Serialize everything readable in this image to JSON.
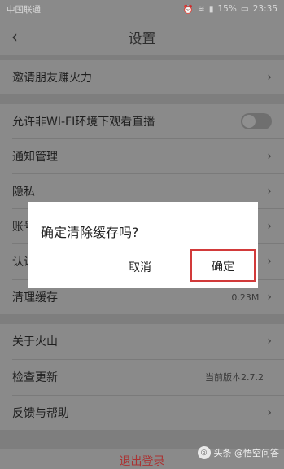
{
  "status_bar": {
    "carrier": "中国联通",
    "battery": "15%",
    "time": "23:35"
  },
  "header": {
    "back_icon": "‹",
    "title": "设置"
  },
  "rows": {
    "invite": "邀请朋友赚火力",
    "non_wifi": "允许非WI-FI环境下观看直播",
    "notification": "通知管理",
    "privacy": "隐私",
    "account": "账号",
    "cert": "认证",
    "clear_cache": "清理缓存",
    "cache_size": "0.23M",
    "about": "关于火山",
    "check_update": "检查更新",
    "version": "当前版本2.7.2",
    "feedback": "反馈与帮助"
  },
  "logout": "退出登录",
  "dialog": {
    "message": "确定清除缓存吗?",
    "cancel": "取消",
    "confirm": "确定"
  },
  "watermark": "头条 @悟空问答"
}
